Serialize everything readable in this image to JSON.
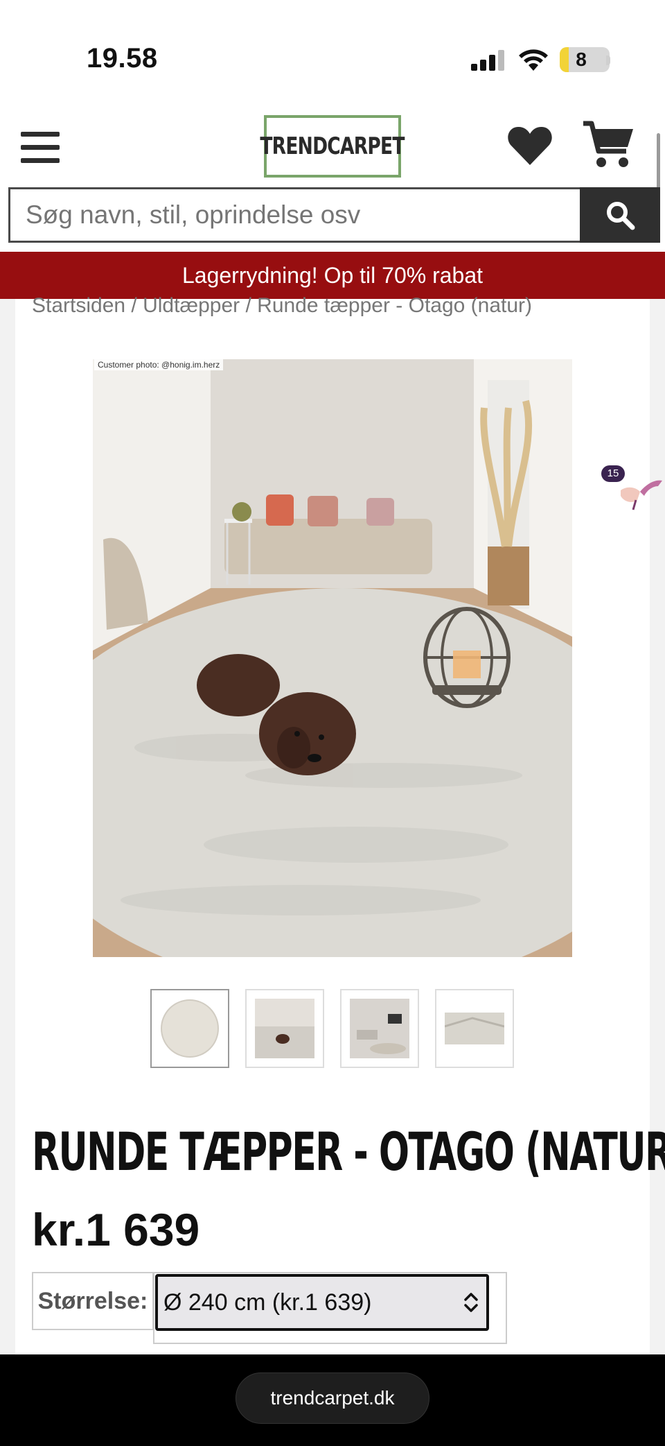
{
  "status": {
    "time": "19.58",
    "battery": "8",
    "battery_level": 0.08
  },
  "header": {
    "logo": "TRENDCARPET",
    "icons": [
      "menu-icon",
      "heart-icon",
      "cart-icon"
    ]
  },
  "search": {
    "placeholder": "Søg navn, stil, oprindelse osv",
    "icon": "search-icon"
  },
  "promo": {
    "text": "Lagerrydning! Op til 70% rabat",
    "color": "#970e10"
  },
  "breadcrumb": {
    "text": "Startsiden / Uldtæpper / Runde tæpper - Otago (natur)"
  },
  "gallery": {
    "credit": "Customer photo: @honig.im.herz",
    "thumbnail_count": 4,
    "active_thumbnail": 1
  },
  "product": {
    "title": "RUNDE TÆPPER - OTAGO (NATUR)",
    "price": "kr.1 639",
    "size_label": "Størrelse:",
    "size_value": "Ø 240 cm (kr.1 639)"
  },
  "widget": {
    "badge": "15"
  },
  "browser": {
    "url": "trendcarpet.dk"
  },
  "colors": {
    "brand_green": "#7aa56a",
    "dark": "#2f2f2f"
  }
}
